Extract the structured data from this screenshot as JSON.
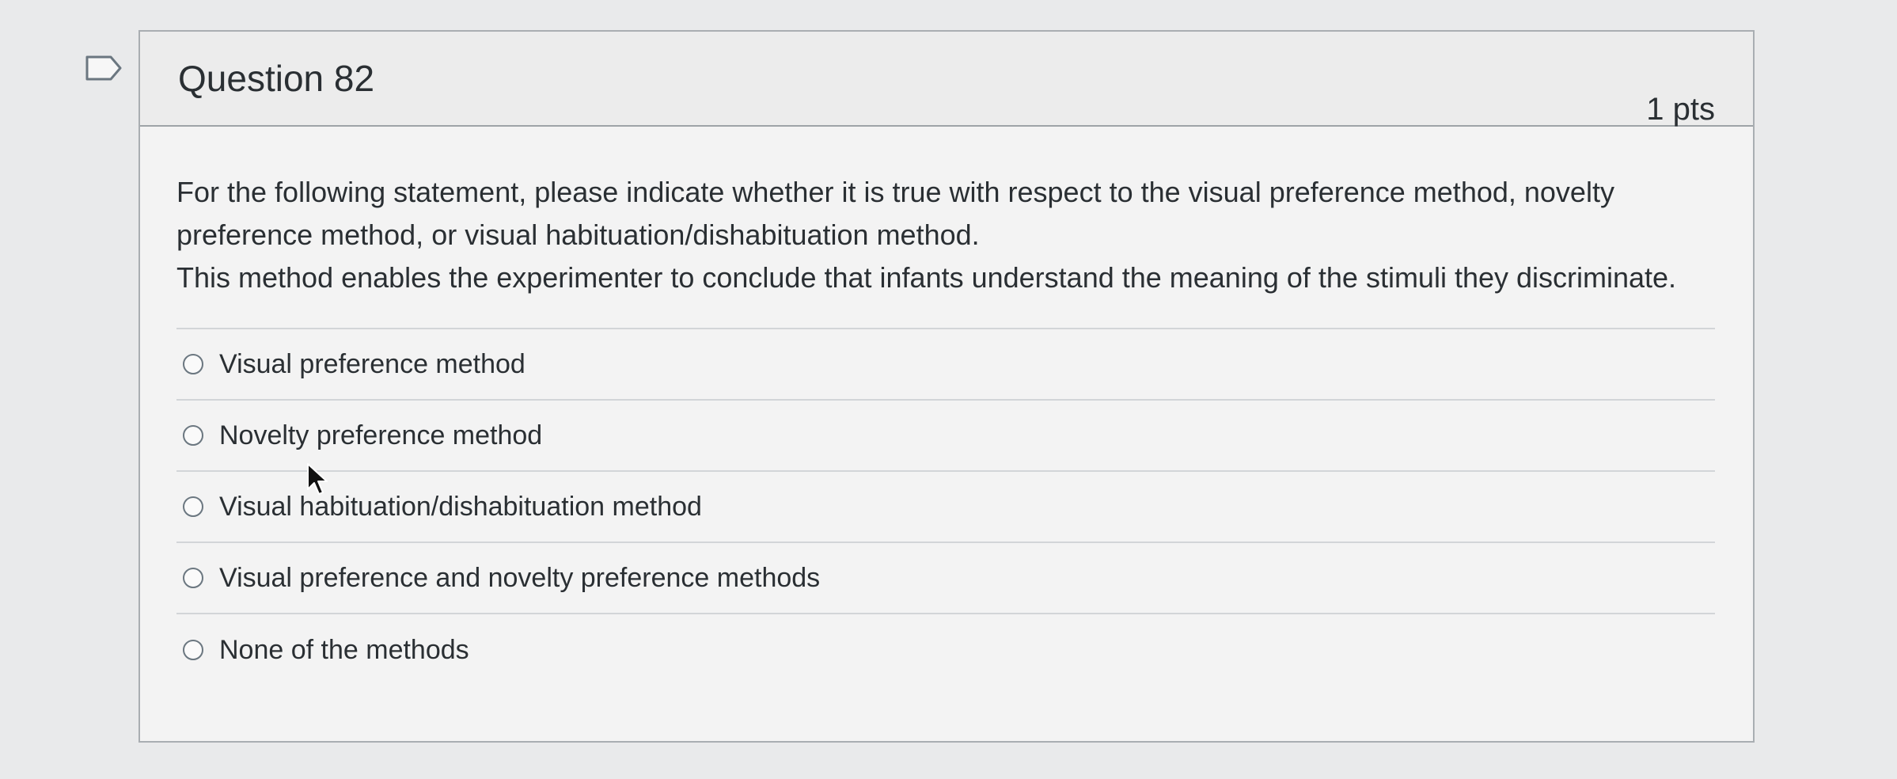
{
  "question": {
    "title": "Question 82",
    "points": "1 pts",
    "flag_icon": "flag-icon",
    "prompt_line_1": "For the following statement, please indicate whether it is true with respect to the visual preference method, novelty preference method, or visual habituation/dishabituation method.",
    "prompt_line_2": "This method enables the experimenter to conclude that infants understand the meaning of the stimuli they discriminate.",
    "answers": [
      {
        "label": "Visual preference method",
        "selected": false
      },
      {
        "label": "Novelty preference method",
        "selected": false
      },
      {
        "label": "Visual habituation/dishabituation method",
        "selected": false
      },
      {
        "label": "Visual preference and novelty preference methods",
        "selected": false
      },
      {
        "label": "None of the methods",
        "selected": false
      }
    ]
  },
  "colors": {
    "background": "#e9eaeb",
    "card": "#f3f3f3",
    "border": "#a9aeb2",
    "text": "#2a2f33",
    "radio_border": "#6b7780"
  }
}
